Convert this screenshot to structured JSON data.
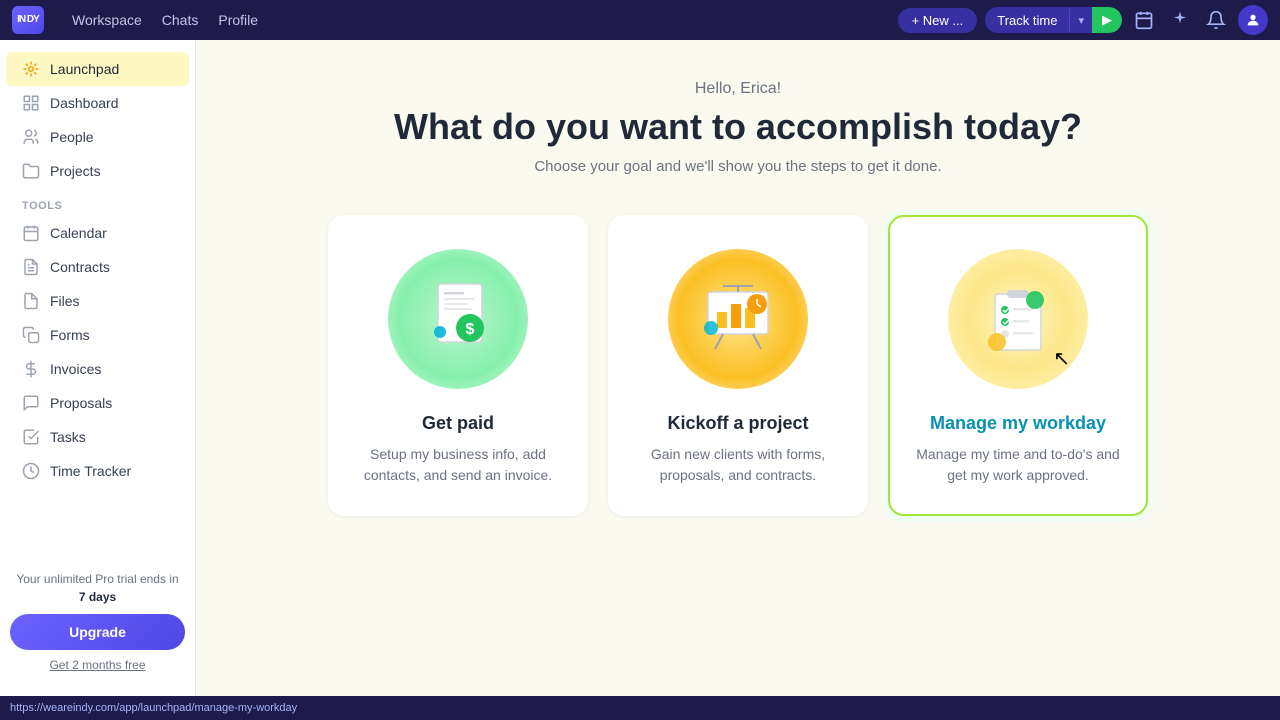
{
  "topnav": {
    "logo_text": "IN DY",
    "links": [
      {
        "label": "Workspace",
        "key": "workspace"
      },
      {
        "label": "Chats",
        "key": "chats"
      },
      {
        "label": "Profile",
        "key": "profile"
      }
    ],
    "new_button_label": "+ New ...",
    "track_time_label": "Track time",
    "track_time_chevron": "▾",
    "play_icon": "▶"
  },
  "sidebar": {
    "items": [
      {
        "label": "Launchpad",
        "key": "launchpad",
        "active": true
      },
      {
        "label": "Dashboard",
        "key": "dashboard"
      },
      {
        "label": "People",
        "key": "people"
      },
      {
        "label": "Projects",
        "key": "projects"
      }
    ],
    "tools_label": "Tools",
    "tools": [
      {
        "label": "Calendar",
        "key": "calendar"
      },
      {
        "label": "Contracts",
        "key": "contracts"
      },
      {
        "label": "Files",
        "key": "files"
      },
      {
        "label": "Forms",
        "key": "forms"
      },
      {
        "label": "Invoices",
        "key": "invoices"
      },
      {
        "label": "Proposals",
        "key": "proposals"
      },
      {
        "label": "Tasks",
        "key": "tasks"
      },
      {
        "label": "Time Tracker",
        "key": "time-tracker"
      }
    ],
    "trial_text_1": "Your unlimited Pro trial ends in",
    "trial_days": "7 days",
    "upgrade_label": "Upgrade",
    "free_months_label": "Get 2 months free"
  },
  "main": {
    "greeting": "Hello, Erica!",
    "heading": "What do you want to accomplish today?",
    "subheading": "Choose your goal and we'll show you the steps to get it done.",
    "cards": [
      {
        "key": "get-paid",
        "title": "Get paid",
        "desc": "Setup my business info, add contacts, and send an invoice.",
        "active": false
      },
      {
        "key": "kickoff-project",
        "title": "Kickoff a project",
        "desc": "Gain new clients with forms, proposals, and contracts.",
        "active": false
      },
      {
        "key": "manage-workday",
        "title": "Manage my workday",
        "desc": "Manage my time and to-do's and get my work approved.",
        "active": true
      }
    ]
  },
  "statusbar": {
    "url": "https://weareindy.com/app/launchpad/manage-my-workday"
  }
}
